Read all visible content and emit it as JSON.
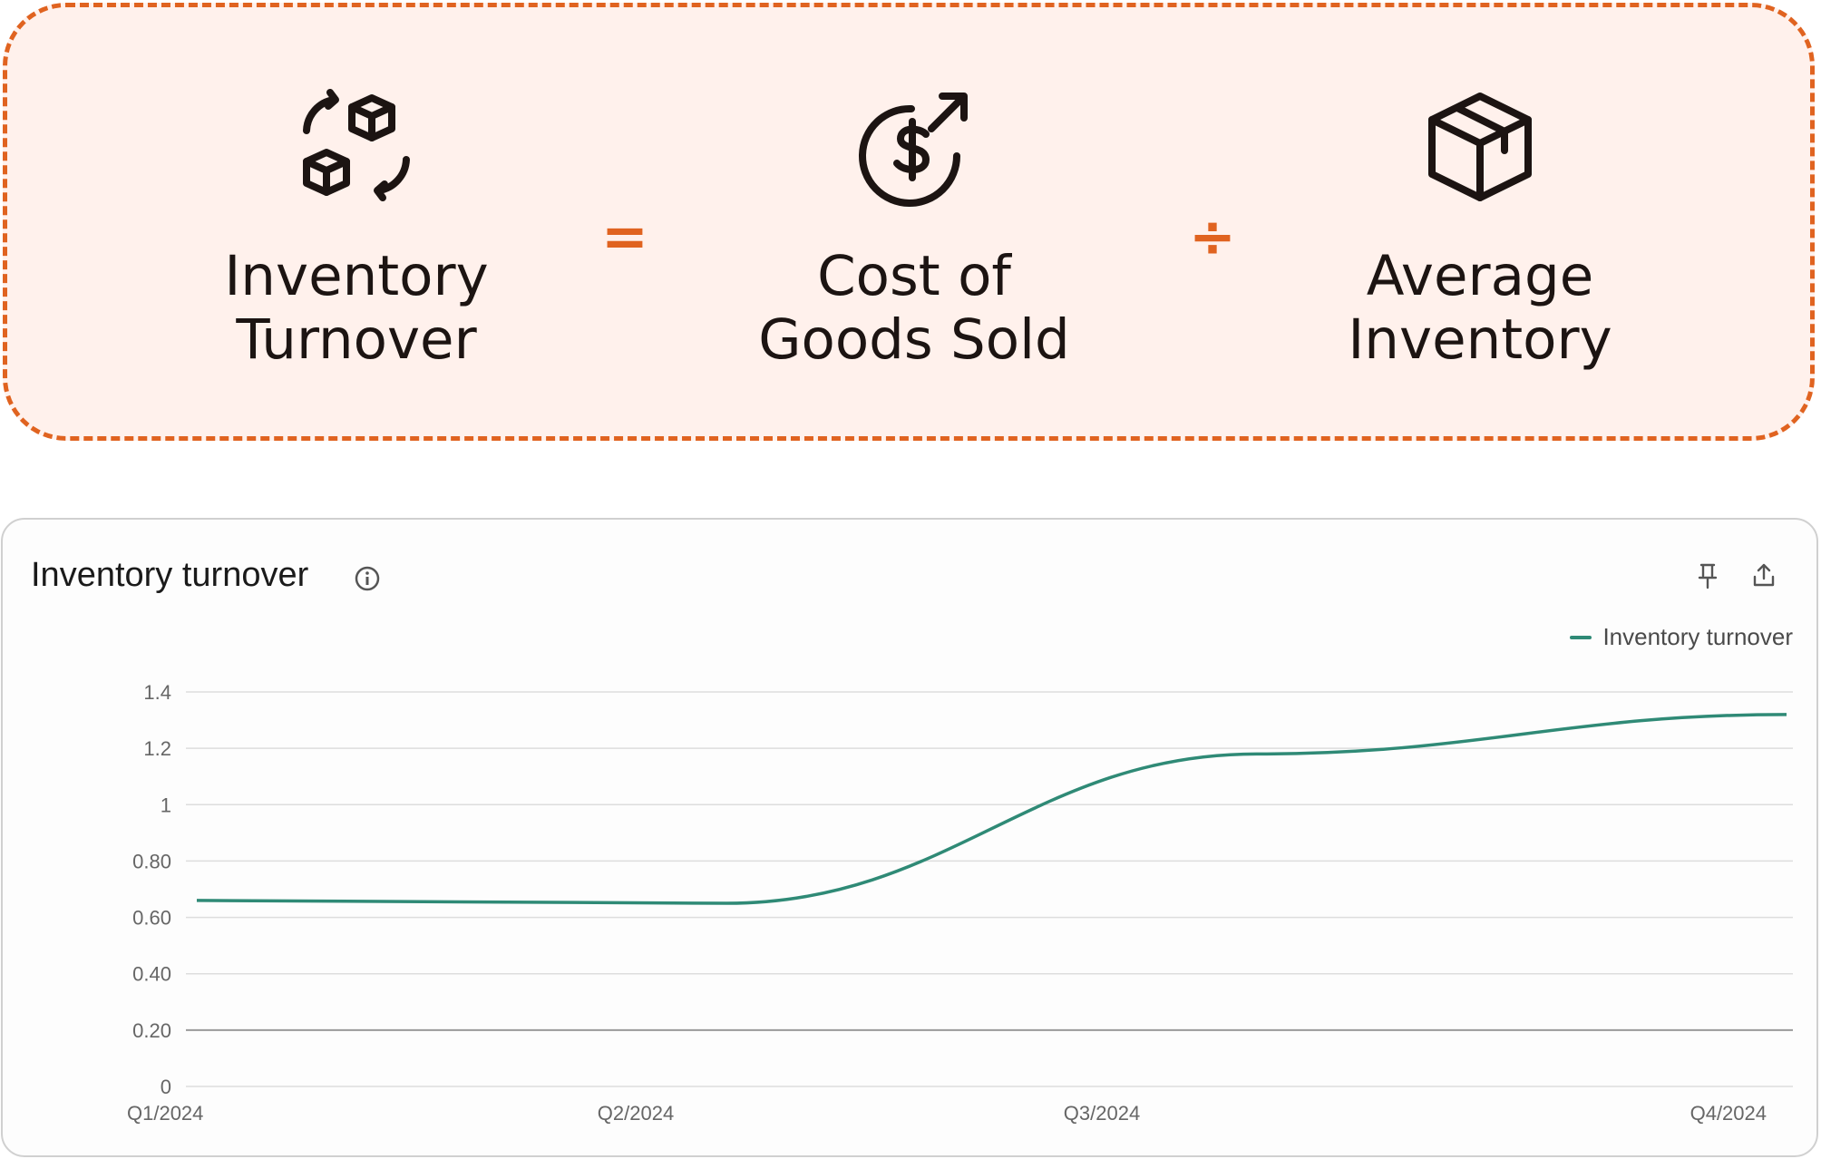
{
  "formula": {
    "result": {
      "line1": "Inventory",
      "line2": "Turnover",
      "icon": "boxes-cycle-icon"
    },
    "equals": "=",
    "numerator": {
      "line1": "Cost of",
      "line2": "Goods Sold",
      "icon": "dollar-growth-icon"
    },
    "divide": "÷",
    "denominator": {
      "line1": "Average",
      "line2": "Inventory",
      "icon": "package-box-icon"
    },
    "accent_color": "#e06320",
    "background_color": "#fff1ec"
  },
  "card": {
    "title": "Inventory turnover",
    "info_icon": "info-icon",
    "pin_icon": "pin-icon",
    "share_icon": "upload-share-icon"
  },
  "chart_data": {
    "type": "line",
    "title": "Inventory turnover",
    "xlabel": "",
    "ylabel": "",
    "categories": [
      "Q1/2024",
      "Q2/2024",
      "Q3/2024",
      "Q4/2024"
    ],
    "x_tick_labels": [
      "Q1/2024",
      "Q2/2024",
      "Q3/2024",
      "Q4/2024"
    ],
    "y_tick_labels": [
      "0",
      "0.20",
      "0.40",
      "0.60",
      "0.80",
      "1",
      "1.2",
      "1.4"
    ],
    "ylim": [
      0,
      1.4
    ],
    "series": [
      {
        "name": "Inventory turnover",
        "color": "#2f8a76",
        "values": [
          0.66,
          0.65,
          1.18,
          1.32
        ]
      }
    ],
    "legend_position": "top-right",
    "grid": true
  }
}
